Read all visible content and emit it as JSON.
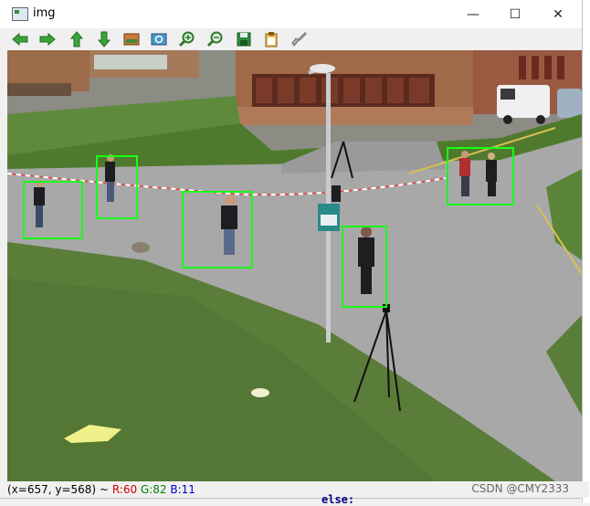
{
  "window": {
    "title": "img"
  },
  "controls": {
    "minimize": "—",
    "maximize": "☐",
    "close": "✕"
  },
  "toolbar": [
    {
      "name": "pan-left-button",
      "icon": "arrow-left-icon"
    },
    {
      "name": "pan-right-button",
      "icon": "arrow-right-icon"
    },
    {
      "name": "pan-up-button",
      "icon": "arrow-up-icon"
    },
    {
      "name": "pan-down-button",
      "icon": "arrow-down-icon"
    },
    {
      "name": "zoom-fit-button",
      "icon": "image-icon"
    },
    {
      "name": "zoom-region-button",
      "icon": "zoom-window-icon"
    },
    {
      "name": "zoom-in-button",
      "icon": "zoom-in-icon"
    },
    {
      "name": "zoom-out-button",
      "icon": "zoom-out-icon"
    },
    {
      "name": "save-button",
      "icon": "save-icon"
    },
    {
      "name": "copy-button",
      "icon": "clipboard-icon"
    },
    {
      "name": "properties-button",
      "icon": "brush-icon"
    }
  ],
  "status": {
    "coords": "(x=657, y=568) ~",
    "r": "R:60",
    "g": "G:82",
    "b": "B:11"
  },
  "watermark": "CSDN @CMY2333",
  "background_code": "else:",
  "colors": {
    "detection_box": "#18ff18",
    "grass": "#5b7d3a",
    "road": "#a8a8a8"
  }
}
